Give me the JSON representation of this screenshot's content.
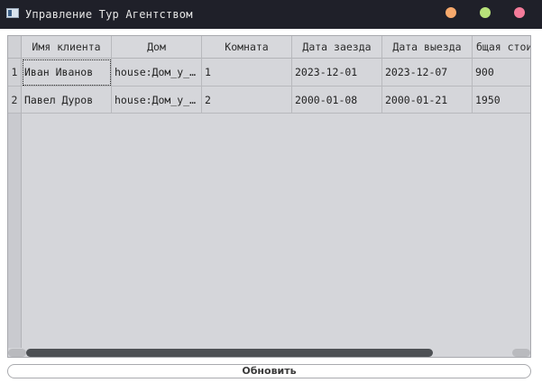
{
  "window": {
    "title": "Управление Тур Агентством"
  },
  "table": {
    "columns": [
      "Имя клиента",
      "Дом",
      "Комната",
      "Дата заезда",
      "Дата выезда",
      "бщая стои"
    ],
    "rows": [
      {
        "row_number": "1",
        "cells": [
          "Иван Иванов",
          "house:Дом_у_…",
          "1",
          "2023-12-01",
          "2023-12-07",
          "900"
        ]
      },
      {
        "row_number": "2",
        "cells": [
          "Павел Дуров",
          "house:Дом_у_…",
          "2",
          "2000-01-08",
          "2000-01-21",
          "1950"
        ]
      }
    ],
    "scroll": {
      "horizontal_thumb_fraction": 0.86,
      "horizontal_position_fraction": 0.0
    }
  },
  "actions": {
    "refresh_label": "Обновить"
  },
  "colors": {
    "titlebar_bg": "#1f2029",
    "minimize_dot": "#f7a96c",
    "maximize_dot": "#b8e27a",
    "close_dot": "#f47b9a",
    "table_bg": "#d5d6da"
  }
}
